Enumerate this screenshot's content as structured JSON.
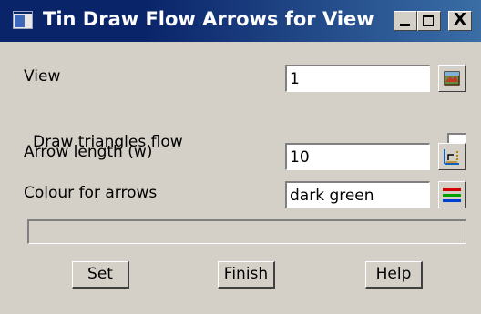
{
  "window": {
    "title": "Tin Draw Flow Arrows for View",
    "controls": {
      "minimize": "_",
      "maximize": "□",
      "close": "X"
    }
  },
  "form": {
    "view": {
      "label": "View",
      "value": "1",
      "icon": "model-picker-icon"
    },
    "draw_triangles": {
      "label": "Draw triangles flow",
      "checked": false
    },
    "arrow_length": {
      "label": "Arrow length (w)",
      "value": "10",
      "icon": "measure-icon"
    },
    "colour": {
      "label": "Colour for arrows",
      "value": "dark green",
      "icon": "colour-picker-icon"
    }
  },
  "status": {
    "text": ""
  },
  "buttons": {
    "set": "Set",
    "finish": "Finish",
    "help": "Help"
  },
  "colors": {
    "titlebar": "#0a246a",
    "dialog_bg": "#d4d0c8",
    "colour_icon_lines": [
      "#d00000",
      "#00a000",
      "#0040d0"
    ]
  }
}
